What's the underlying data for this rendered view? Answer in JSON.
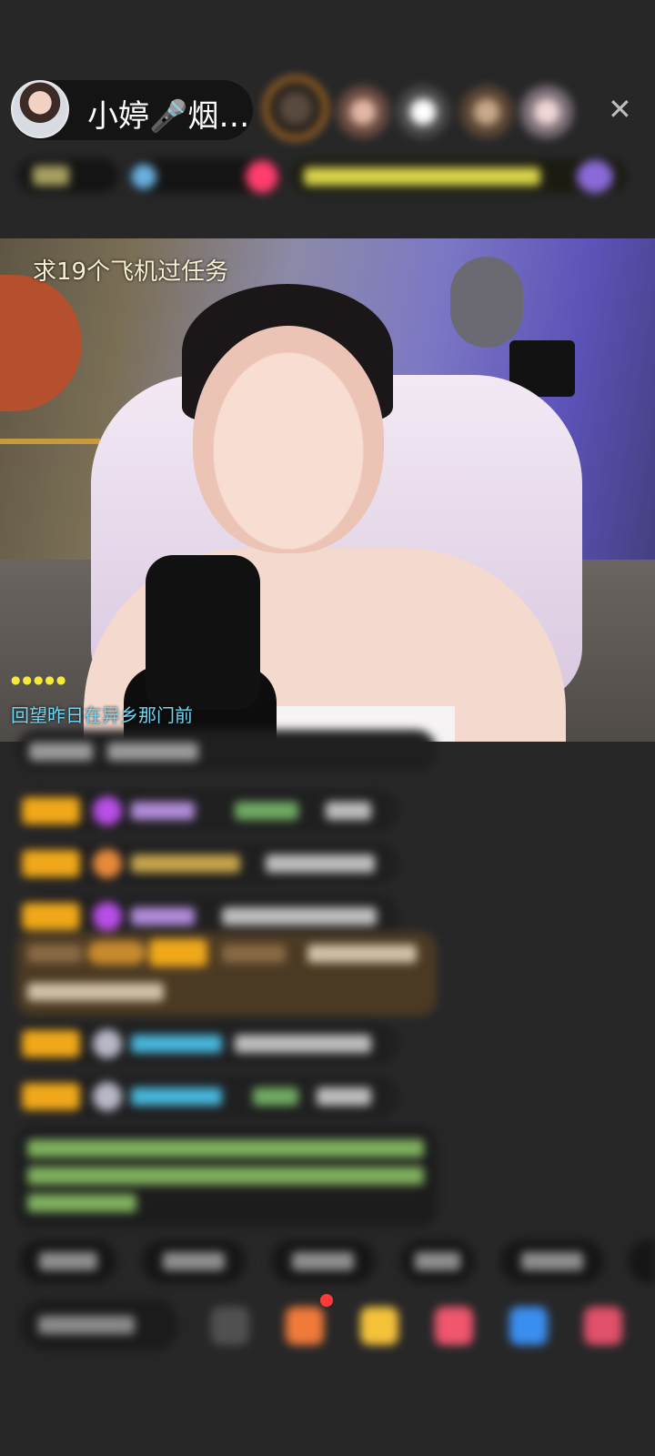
{
  "header": {
    "host_name": "小婷🎤烟…",
    "close_icon": "✕"
  },
  "video": {
    "task_text": "求19个飞机过任务",
    "dots": "●●●●●",
    "song_lyric": "回望昨日在异乡那门前"
  },
  "colors": {
    "background": "#272728",
    "badge": "#f0a81a",
    "song_text": "#72d6f2",
    "gift_bg": "#4b3a23"
  },
  "icons": [
    "close-icon",
    "emoji-icon",
    "gift-box-icon",
    "treasure-icon",
    "heart-gift-icon",
    "game-icon",
    "more-grid-icon"
  ]
}
